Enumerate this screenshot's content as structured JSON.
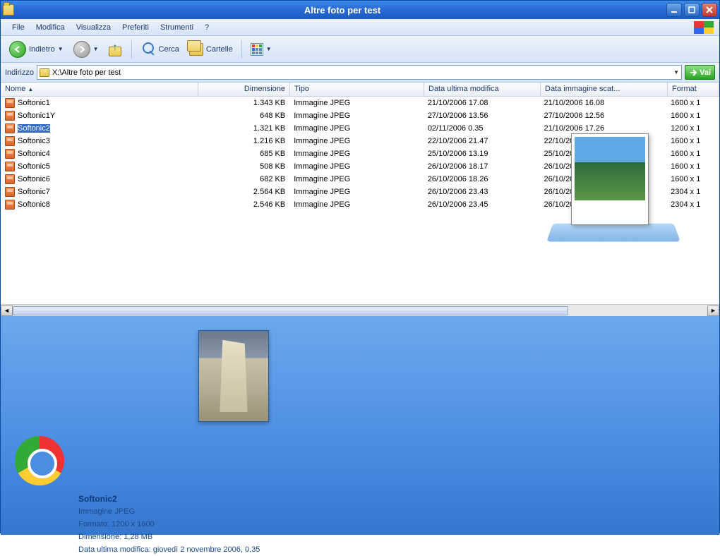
{
  "window": {
    "title": "Altre foto per test"
  },
  "menu": {
    "file": "File",
    "modifica": "Modifica",
    "visualizza": "Visualizza",
    "preferiti": "Preferiti",
    "strumenti": "Strumenti",
    "help": "?"
  },
  "toolbar": {
    "back": "Indietro",
    "search": "Cerca",
    "folders": "Cartelle"
  },
  "address": {
    "label": "Indirizzo",
    "path": "X:\\Altre foto per test",
    "go": "Vai"
  },
  "columns": {
    "nome": "Nome",
    "dimensione": "Dimensione",
    "tipo": "Tipo",
    "data_mod": "Data ultima modifica",
    "data_img": "Data immagine scat...",
    "formato": "Format"
  },
  "files": [
    {
      "nome": "Softonic1",
      "dim": "1.343 KB",
      "tipo": "Immagine JPEG",
      "data_mod": "21/10/2006 17.08",
      "data_img": "21/10/2006 16.08",
      "fmt": "1600 x 1"
    },
    {
      "nome": "Softonic1Y",
      "dim": "648 KB",
      "tipo": "Immagine JPEG",
      "data_mod": "27/10/2006 13.56",
      "data_img": "27/10/2006 12.56",
      "fmt": "1600 x 1"
    },
    {
      "nome": "Softonic2",
      "dim": "1.321 KB",
      "tipo": "Immagine JPEG",
      "data_mod": "02/11/2006 0.35",
      "data_img": "21/10/2006 17.26",
      "fmt": "1200 x 1",
      "selected": true
    },
    {
      "nome": "Softonic3",
      "dim": "1.216 KB",
      "tipo": "Immagine JPEG",
      "data_mod": "22/10/2006 21.47",
      "data_img": "22/10/2006 20.47",
      "fmt": "1600 x 1"
    },
    {
      "nome": "Softonic4",
      "dim": "685 KB",
      "tipo": "Immagine JPEG",
      "data_mod": "25/10/2006 13.19",
      "data_img": "25/10/2006 12.19",
      "fmt": "1600 x 1"
    },
    {
      "nome": "Softonic5",
      "dim": "508 KB",
      "tipo": "Immagine JPEG",
      "data_mod": "26/10/2006 18.17",
      "data_img": "26/10/2006 17.17",
      "fmt": "1600 x 1"
    },
    {
      "nome": "Softonic6",
      "dim": "682 KB",
      "tipo": "Immagine JPEG",
      "data_mod": "26/10/2006 18.26",
      "data_img": "26/10/2006 17.26",
      "fmt": "1600 x 1"
    },
    {
      "nome": "Softonic7",
      "dim": "2.564 KB",
      "tipo": "Immagine JPEG",
      "data_mod": "26/10/2006 23.43",
      "data_img": "26/10/2006 22.43",
      "fmt": "2304 x 1"
    },
    {
      "nome": "Softonic8",
      "dim": "2.546 KB",
      "tipo": "Immagine JPEG",
      "data_mod": "26/10/2006 23.45",
      "data_img": "26/10/2006 22.45",
      "fmt": "2304 x 1"
    }
  ],
  "details": {
    "title": "Softonic2",
    "type": "Immagine JPEG",
    "formato": "Formato: 1200 x 1600",
    "dimensione": "Dimensione: 1,28 MB",
    "data_mod": "Data ultima modifica: giovedì 2 novembre 2006, 0.35"
  }
}
